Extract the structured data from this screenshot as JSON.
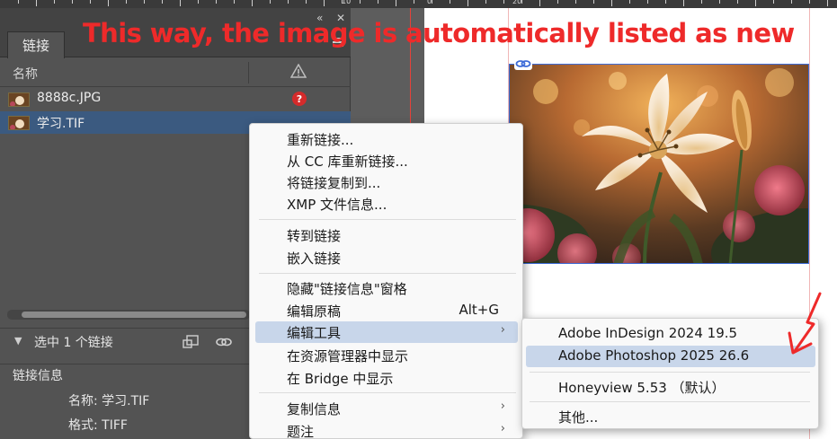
{
  "annotation": {
    "text": "This way, the image is automatically listed as new",
    "color": "#ee2a2a"
  },
  "ruler": {
    "labels": [
      "10",
      "0",
      "20"
    ]
  },
  "panel": {
    "tab_label": "链接",
    "column_name": "名称",
    "links": [
      {
        "name": "8888c.JPG",
        "status": "?"
      },
      {
        "name": "学习.TIF",
        "status": ""
      }
    ],
    "selected_summary": "选中 1 个链接",
    "info_title": "链接信息",
    "info": [
      {
        "label": "名称:",
        "value": "学习.TIF"
      },
      {
        "label": "格式:",
        "value": "TIFF"
      }
    ]
  },
  "context_menu": {
    "items": [
      {
        "label": "重新链接...",
        "shortcut": "",
        "submenu": false
      },
      {
        "label": "从 CC 库重新链接...",
        "shortcut": "",
        "submenu": false
      },
      {
        "label": "将链接复制到...",
        "shortcut": "",
        "submenu": false
      },
      {
        "label": "XMP 文件信息...",
        "shortcut": "",
        "submenu": false
      },
      {
        "label": "转到链接",
        "shortcut": "",
        "submenu": false
      },
      {
        "label": "嵌入链接",
        "shortcut": "",
        "submenu": false
      },
      {
        "label": "隐藏\"链接信息\"窗格",
        "shortcut": "",
        "submenu": false
      },
      {
        "label": "编辑原稿",
        "shortcut": "Alt+G",
        "submenu": false
      },
      {
        "label": "编辑工具",
        "shortcut": "",
        "submenu": true
      },
      {
        "label": "在资源管理器中显示",
        "shortcut": "",
        "submenu": false
      },
      {
        "label": "在 Bridge 中显示",
        "shortcut": "",
        "submenu": false
      },
      {
        "label": "复制信息",
        "shortcut": "",
        "submenu": true
      },
      {
        "label": "题注",
        "shortcut": "",
        "submenu": true
      }
    ]
  },
  "submenu": {
    "items": [
      {
        "label": "Adobe InDesign 2024 19.5"
      },
      {
        "label": "Adobe Photoshop 2025 26.6"
      },
      {
        "label": "Honeyview 5.53 （默认）"
      },
      {
        "label": "其他..."
      }
    ]
  },
  "colors": {
    "panel_bg": "#535353",
    "selection": "#3b5a80",
    "menu_highlight": "#c8d6ea"
  }
}
